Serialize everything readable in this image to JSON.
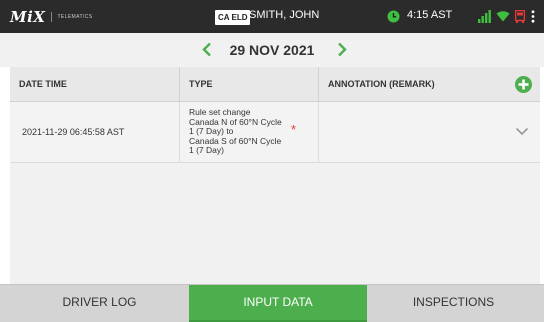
{
  "status_bar": {
    "logo_text": "MiX",
    "logo_subtext": "TELEMATICS",
    "eld_badge": "CA ELD",
    "driver_name": "SMITH, JOHN",
    "time": "4:15 AST",
    "icons": [
      "mix-logo",
      "clock-icon",
      "signal-icon",
      "wifi-icon",
      "truck-icon",
      "overflow-menu-icon"
    ]
  },
  "date_nav": {
    "date": "29 NOV 2021",
    "prev_icon": "chevron-left-icon",
    "next_icon": "chevron-right-icon",
    "accent_color": "#4cae4c"
  },
  "table": {
    "columns": [
      "DATE TIME",
      "TYPE",
      "ANNOTATION (REMARK)"
    ],
    "add_icon": "plus-circle-icon",
    "rows": [
      {
        "date_time": "2021-11-29 06:45:58 AST",
        "type_lines": [
          "Rule set change",
          "Canada N of 60°N Cycle",
          "1 (7 Day) to",
          "Canada S of 60°N Cycle",
          "1 (7 Day)"
        ],
        "required_marker": "*",
        "annotation": "",
        "expand_icon": "chevron-down-icon"
      }
    ]
  },
  "tabs": [
    {
      "label": "DRIVER LOG",
      "active": false
    },
    {
      "label": "INPUT DATA",
      "active": true
    },
    {
      "label": "INSPECTIONS",
      "active": false
    }
  ],
  "colors": {
    "top_bar": "#2b2b2b",
    "active_tab": "#4cae4c",
    "required_marker": "#e53935"
  }
}
